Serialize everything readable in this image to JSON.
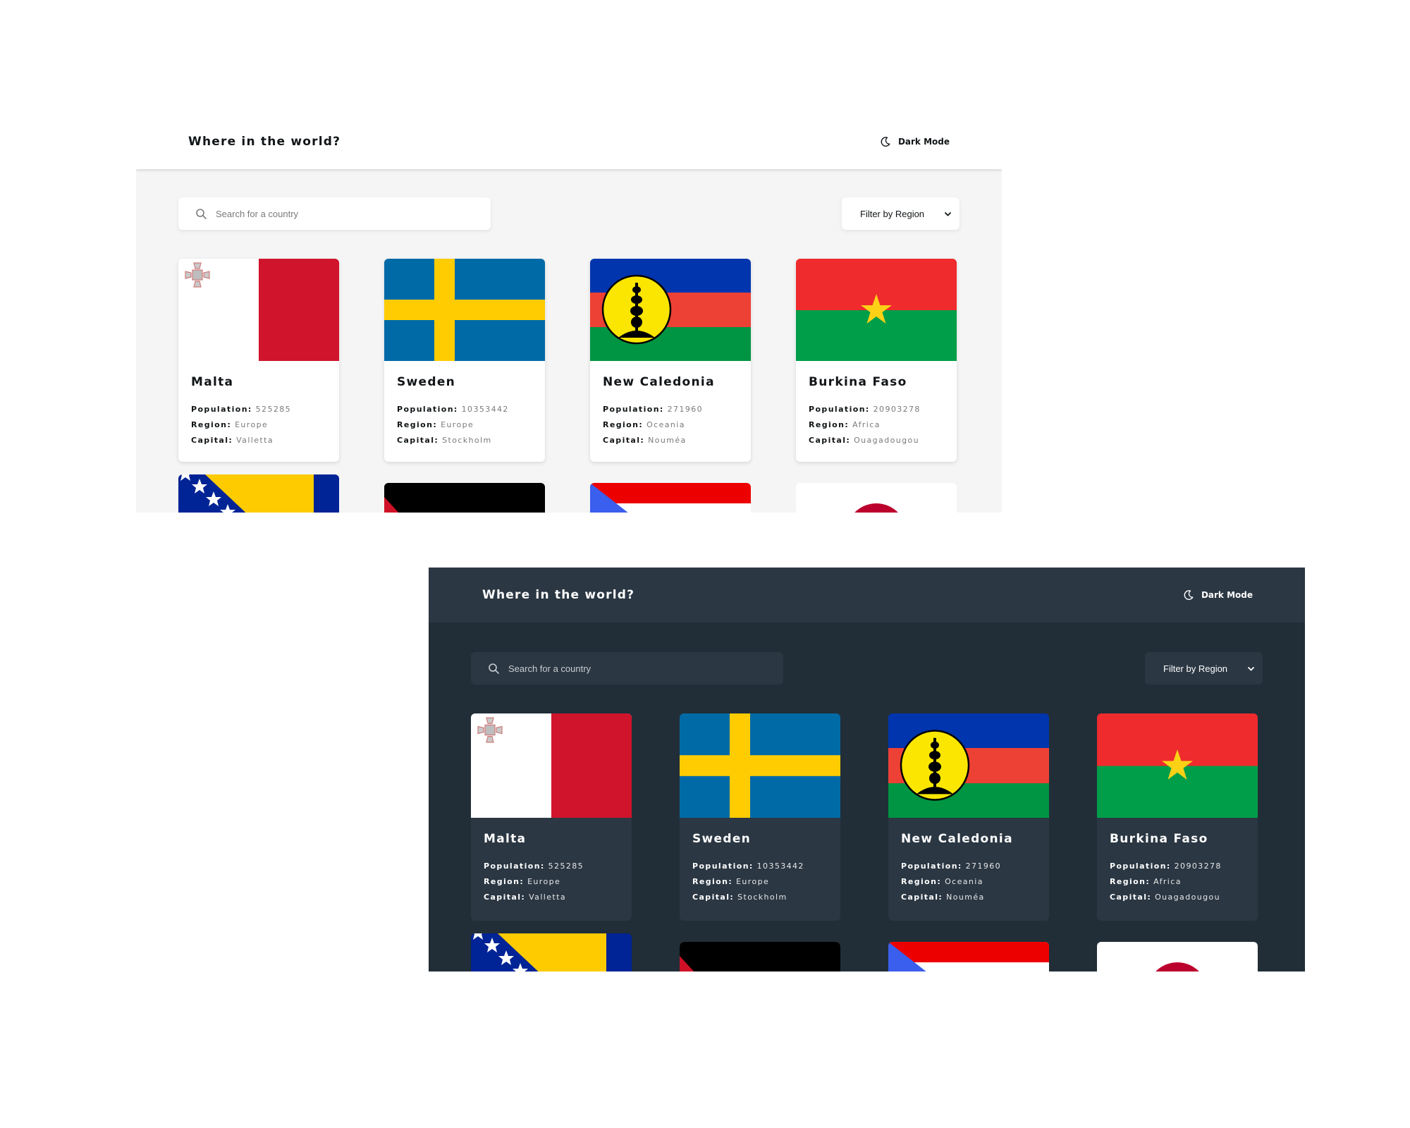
{
  "light": {
    "header": {
      "title": "Where in the world?",
      "mode_label": "Dark Mode"
    },
    "search": {
      "placeholder": "Search for a country"
    },
    "filter": {
      "label": "Filter by Region"
    },
    "countries": [
      {
        "name": "Malta",
        "population": "525285",
        "region": "Europe",
        "capital": "Valletta",
        "flag_icon": "flag-malta"
      },
      {
        "name": "Sweden",
        "population": "10353442",
        "region": "Europe",
        "capital": "Stockholm",
        "flag_icon": "flag-sweden"
      },
      {
        "name": "New Caledonia",
        "population": "271960",
        "region": "Oceania",
        "capital": "Nouméa",
        "flag_icon": "flag-new-caledonia"
      },
      {
        "name": "Burkina Faso",
        "population": "20903278",
        "region": "Africa",
        "capital": "Ouagadougou",
        "flag_icon": "flag-burkina-faso"
      }
    ]
  },
  "dark": {
    "header": {
      "title": "Where in the world?",
      "mode_label": "Dark Mode"
    },
    "search": {
      "placeholder": "Search for a country"
    },
    "filter": {
      "label": "Filter by Region"
    },
    "countries": [
      {
        "name": "Malta",
        "population": "525285",
        "region": "Europe",
        "capital": "Valletta",
        "flag_icon": "flag-malta"
      },
      {
        "name": "Sweden",
        "population": "10353442",
        "region": "Europe",
        "capital": "Stockholm",
        "flag_icon": "flag-sweden"
      },
      {
        "name": "New Caledonia",
        "population": "271960",
        "region": "Oceania",
        "capital": "Nouméa",
        "flag_icon": "flag-new-caledonia"
      },
      {
        "name": "Burkina Faso",
        "population": "20903278",
        "region": "Africa",
        "capital": "Ouagadougou",
        "flag_icon": "flag-burkina-faso"
      }
    ]
  },
  "labels": {
    "population": "Population:",
    "region": "Region:",
    "capital": "Capital:"
  },
  "colors": {
    "light_background": "#f5f5f5",
    "light_element": "#ffffff",
    "dark_background": "#212e38",
    "dark_element": "#2b3743"
  },
  "icons": {
    "mode": "moon-icon",
    "search": "search-icon",
    "filter": "chevron-down-icon"
  }
}
